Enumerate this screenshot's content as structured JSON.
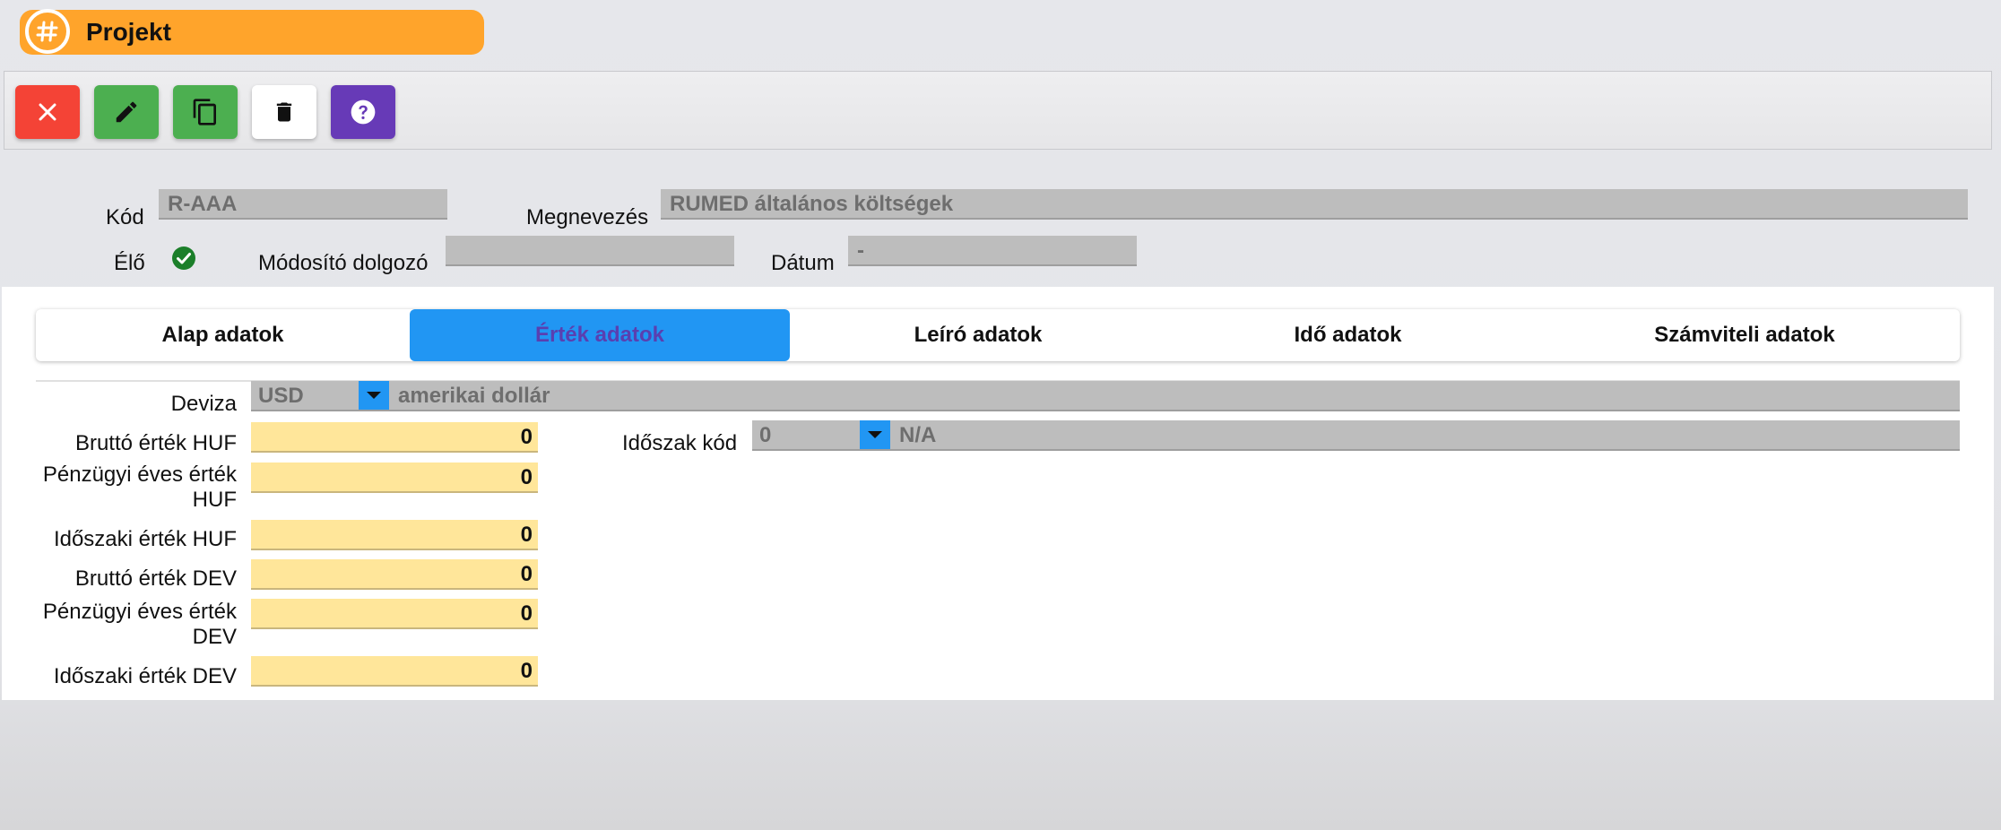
{
  "app": {
    "title": "Projekt"
  },
  "colors": {
    "title_accent": "#ffa42b",
    "tab_active": "#2196f3",
    "number_field": "#ffe69a"
  },
  "toolbar": {
    "buttons": [
      {
        "name": "close",
        "icon": "close-icon"
      },
      {
        "name": "edit",
        "icon": "pencil-icon"
      },
      {
        "name": "copy",
        "icon": "copy-icon"
      },
      {
        "name": "delete",
        "icon": "trash-icon"
      },
      {
        "name": "help",
        "icon": "help-icon"
      }
    ]
  },
  "header": {
    "kod_label": "Kód",
    "kod_value": "R-AAA",
    "megnevezes_label": "Megnevezés",
    "megnevezes_value": "RUMED általános költségek",
    "elo_label": "Élő",
    "elo_checked": true,
    "modosito_label": "Módosító dolgozó",
    "modosito_value": "",
    "datum_label": "Dátum",
    "datum_value": "-"
  },
  "tabs": [
    {
      "label": "Alap adatok",
      "active": false
    },
    {
      "label": "Érték adatok",
      "active": true
    },
    {
      "label": "Leíró adatok",
      "active": false
    },
    {
      "label": "Idő adatok",
      "active": false
    },
    {
      "label": "Számviteli adatok",
      "active": false
    }
  ],
  "form": {
    "deviza_label": "Deviza",
    "deviza_code": "USD",
    "deviza_desc": "amerikai dollár",
    "idoszak_kod_label": "Időszak kód",
    "idoszak_kod_code": "0",
    "idoszak_kod_desc": "N/A",
    "fields": [
      {
        "label": "Bruttó érték HUF",
        "value": "0"
      },
      {
        "label": "Pénzügyi éves érték HUF",
        "value": "0"
      },
      {
        "label": "Időszaki érték HUF",
        "value": "0"
      },
      {
        "label": "Bruttó érték DEV",
        "value": "0"
      },
      {
        "label": "Pénzügyi éves érték DEV",
        "value": "0"
      },
      {
        "label": "Időszaki érték DEV",
        "value": "0"
      }
    ]
  }
}
